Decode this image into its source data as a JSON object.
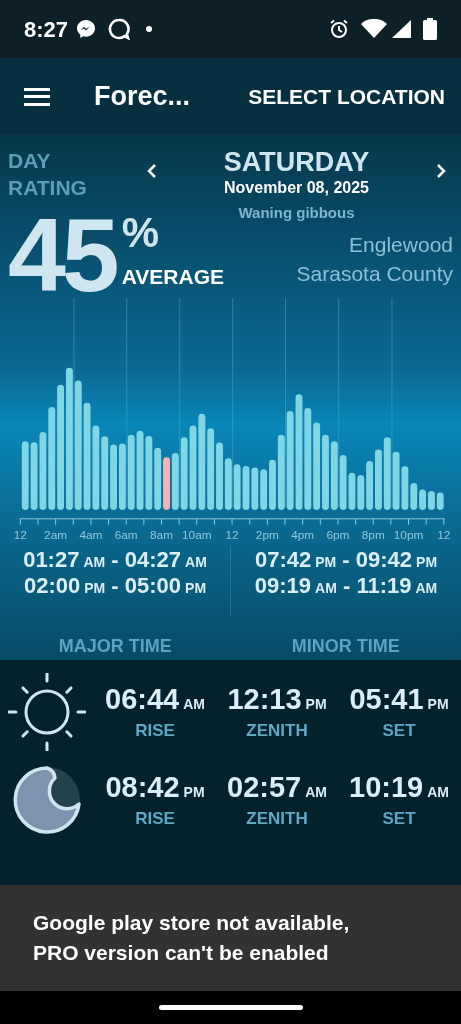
{
  "status_bar": {
    "time": "8:27"
  },
  "app_bar": {
    "title": "Forec...",
    "action": "SELECT LOCATION"
  },
  "day_rating": {
    "label": "DAY RATING",
    "value": "45",
    "unit": "%",
    "verdict": "AVERAGE"
  },
  "date": {
    "day": "SATURDAY",
    "date": "November 08, 2025",
    "moon_phase": "Waning gibbous"
  },
  "location": {
    "place": "Englewood",
    "county": "Sarasota County"
  },
  "chart": {
    "x_labels": [
      "12",
      "2am",
      "4am",
      "6am",
      "8am",
      "10am",
      "12",
      "2pm",
      "4pm",
      "6pm",
      "8pm",
      "10pm",
      "12"
    ]
  },
  "major_times": {
    "label": "MAJOR TIME",
    "ranges": [
      {
        "start": "01:27",
        "start_period": "AM",
        "dash": "-",
        "end": "04:27",
        "end_period": "AM"
      },
      {
        "start": "02:00",
        "start_period": "PM",
        "dash": "-",
        "end": "05:00",
        "end_period": "PM"
      }
    ]
  },
  "minor_times": {
    "label": "MINOR TIME",
    "ranges": [
      {
        "start": "07:42",
        "start_period": "PM",
        "dash": "-",
        "end": "09:42",
        "end_period": "PM"
      },
      {
        "start": "09:19",
        "start_period": "AM",
        "dash": "-",
        "end": "11:19",
        "end_period": "AM"
      }
    ]
  },
  "bodies": [
    {
      "kind": "sun",
      "events": [
        {
          "time": "06:44",
          "period": "AM",
          "label": "RISE"
        },
        {
          "time": "12:13",
          "period": "PM",
          "label": "ZENITH"
        },
        {
          "time": "05:41",
          "period": "PM",
          "label": "SET"
        }
      ]
    },
    {
      "kind": "moon",
      "events": [
        {
          "time": "08:42",
          "period": "PM",
          "label": "RISE"
        },
        {
          "time": "02:57",
          "period": "AM",
          "label": "ZENITH"
        },
        {
          "time": "10:19",
          "period": "AM",
          "label": "SET"
        }
      ]
    }
  ],
  "snackbar": {
    "message": "Google play store not available, PRO version can't be enabled"
  }
}
